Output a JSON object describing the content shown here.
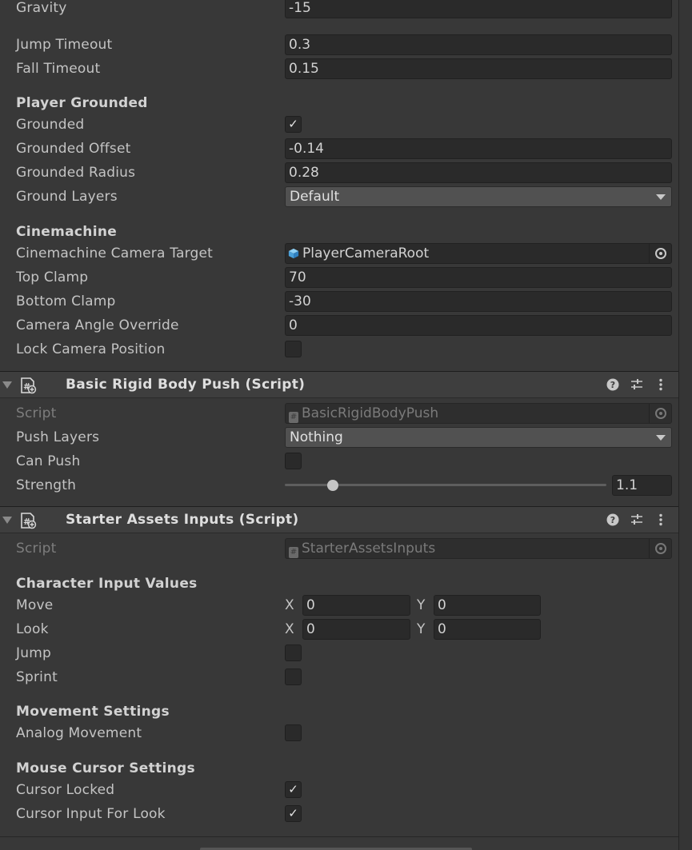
{
  "player": {
    "gravity": {
      "label": "Gravity",
      "value": "-15"
    },
    "jump_timeout": {
      "label": "Jump Timeout",
      "value": "0.3"
    },
    "fall_timeout": {
      "label": "Fall Timeout",
      "value": "0.15"
    },
    "grounded_section": "Player Grounded",
    "grounded": {
      "label": "Grounded",
      "checked": true
    },
    "grounded_offset": {
      "label": "Grounded Offset",
      "value": "-0.14"
    },
    "grounded_radius": {
      "label": "Grounded Radius",
      "value": "0.28"
    },
    "ground_layers": {
      "label": "Ground Layers",
      "value": "Default"
    },
    "cinemachine_section": "Cinemachine",
    "camera_target": {
      "label": "Cinemachine Camera Target",
      "value": "PlayerCameraRoot"
    },
    "top_clamp": {
      "label": "Top Clamp",
      "value": "70"
    },
    "bottom_clamp": {
      "label": "Bottom Clamp",
      "value": "-30"
    },
    "camera_angle_override": {
      "label": "Camera Angle Override",
      "value": "0"
    },
    "lock_camera_position": {
      "label": "Lock Camera Position",
      "checked": false
    }
  },
  "rigid_body_push": {
    "title": "Basic Rigid Body Push (Script)",
    "script": {
      "label": "Script",
      "value": "BasicRigidBodyPush"
    },
    "push_layers": {
      "label": "Push Layers",
      "value": "Nothing"
    },
    "can_push": {
      "label": "Can Push",
      "checked": false
    },
    "strength": {
      "label": "Strength",
      "value": "1.1",
      "fraction": 0.15
    }
  },
  "starter_inputs": {
    "title": "Starter Assets Inputs (Script)",
    "script": {
      "label": "Script",
      "value": "StarterAssetsInputs"
    },
    "character_section": "Character Input Values",
    "move": {
      "label": "Move",
      "x_label": "X",
      "x": "0",
      "y_label": "Y",
      "y": "0"
    },
    "look": {
      "label": "Look",
      "x_label": "X",
      "x": "0",
      "y_label": "Y",
      "y": "0"
    },
    "jump": {
      "label": "Jump",
      "checked": false
    },
    "sprint": {
      "label": "Sprint",
      "checked": false
    },
    "movement_section": "Movement Settings",
    "analog_movement": {
      "label": "Analog Movement",
      "checked": false
    },
    "cursor_section": "Mouse Cursor Settings",
    "cursor_locked": {
      "label": "Cursor Locked",
      "checked": true
    },
    "cursor_input_for_look": {
      "label": "Cursor Input For Look",
      "checked": true
    }
  },
  "icons": {
    "checkmark": "✓",
    "script_glyph": "#"
  },
  "colors": {
    "background": "#383838",
    "field": "#2a2a2a",
    "dropdown": "#515151",
    "header": "#3e3e3e",
    "object_icon": "#5ab0e6"
  }
}
